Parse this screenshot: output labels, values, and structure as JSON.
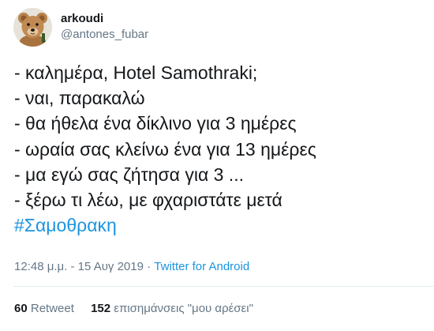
{
  "user": {
    "display_name": "arkoudi",
    "handle": "@antones_fubar",
    "avatar_icon": "teddy-bear-avatar"
  },
  "tweet": {
    "lines": [
      "- καλημέρα, Hotel Samothraki;",
      "- ναι, παρακαλώ",
      "- θα ήθελα ένα δίκλινο για 3 ημέρες",
      "- ωραία σας κλείνω ένα για 13 ημέρες",
      "- μα εγώ σας ζήτησα για 3 ...",
      "- ξέρω τι λέω, με φχαριστάτε μετά"
    ],
    "hashtag": "#Σαμοθρακη"
  },
  "meta": {
    "time": "12:48 μ.μ.",
    "separator": "·",
    "date": "15 Αυγ 2019",
    "source": "Twitter for Android"
  },
  "stats": {
    "retweets_count": "60",
    "retweets_label": "Retweet",
    "likes_count": "152",
    "likes_label": "επισημάνσεις \"μου αρέσει\""
  },
  "colors": {
    "link": "#1b95e0",
    "secondary_text": "#657786",
    "primary_text": "#14171a",
    "divider": "#e6ecf0"
  }
}
